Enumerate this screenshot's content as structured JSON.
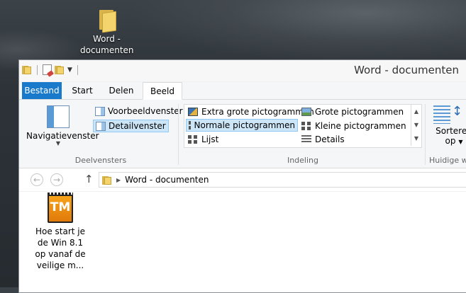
{
  "desktop": {
    "icon_label": "Word -\ndocumenten"
  },
  "window": {
    "title": "Word - documenten"
  },
  "tabs": {
    "file": "Bestand",
    "start": "Start",
    "share": "Delen",
    "view": "Beeld"
  },
  "ribbon": {
    "panes": {
      "nav_pane": "Navigatievenster",
      "preview_pane": "Voorbeeldvenster",
      "details_pane": "Detailvenster",
      "group_label": "Deelvensters"
    },
    "layout": {
      "extra_large": "Extra grote pictogrammen",
      "large": "Grote pictogrammen",
      "medium": "Normale pictogrammen",
      "small": "Kleine pictogrammen",
      "list": "Lijst",
      "details": "Details",
      "group_label": "Indeling"
    },
    "sort": {
      "label_line1": "Sorteren",
      "label_line2": "op",
      "group_label": "Huidige w"
    }
  },
  "address": {
    "path": "Word - documenten"
  },
  "files": [
    {
      "icon": "TM",
      "label": "Hoe start je de Win 8.1 op vanaf de veilige m..."
    }
  ],
  "colors": {
    "file_tab": "#1979ca",
    "selection": "#cde6f7",
    "folder": "#f4d46c"
  }
}
